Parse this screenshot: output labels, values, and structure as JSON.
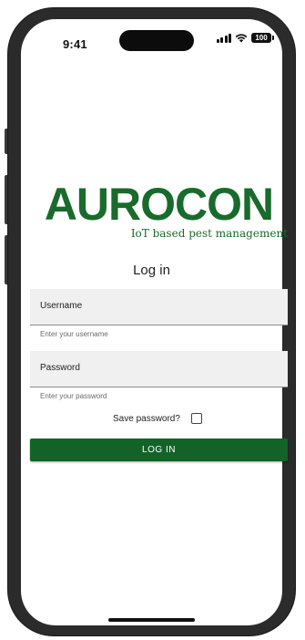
{
  "status_bar": {
    "time": "9:41",
    "battery": "100"
  },
  "logo": {
    "name": "AUROCON",
    "tagline": "IoT based pest management",
    "color": "#196b2c"
  },
  "login": {
    "title": "Log in",
    "username": {
      "label": "Username",
      "helper": "Enter your username"
    },
    "password": {
      "label": "Password",
      "helper": "Enter your password"
    },
    "save_password": {
      "label": "Save password?",
      "checked": false
    },
    "submit_label": "LOG IN"
  },
  "colors": {
    "accent": "#136328",
    "field_background": "#f0f0f0"
  }
}
